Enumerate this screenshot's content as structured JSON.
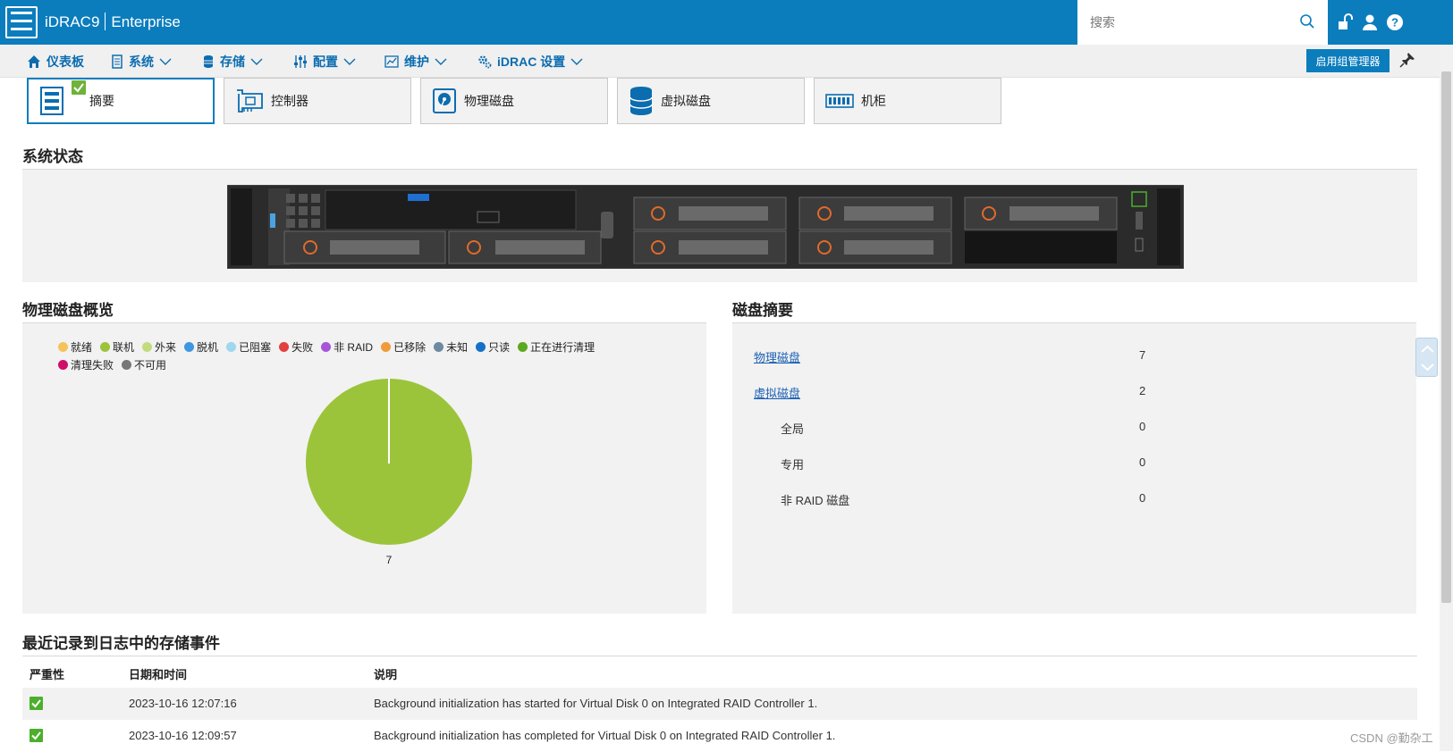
{
  "header": {
    "product": "iDRAC9",
    "edition": "Enterprise",
    "search_placeholder": "搜索",
    "colors": {
      "header_bg": "#0b7dbd",
      "accent": "#0b6db0"
    }
  },
  "nav": {
    "items": [
      {
        "label": "仪表板",
        "icon": "home-icon"
      },
      {
        "label": "系统",
        "icon": "server-icon"
      },
      {
        "label": "存储",
        "icon": "database-icon"
      },
      {
        "label": "配置",
        "icon": "sliders-icon"
      },
      {
        "label": "维护",
        "icon": "chart-icon"
      },
      {
        "label": "iDRAC 设置",
        "icon": "gears-icon"
      }
    ],
    "group_manager_button": "启用组管理器"
  },
  "tabs": [
    {
      "label": "摘要",
      "icon": "summary-icon",
      "active": true
    },
    {
      "label": "控制器",
      "icon": "controller-icon",
      "active": false
    },
    {
      "label": "物理磁盘",
      "icon": "physical-disk-icon",
      "active": false
    },
    {
      "label": "虚拟磁盘",
      "icon": "virtual-disk-icon",
      "active": false
    },
    {
      "label": "机柜",
      "icon": "enclosure-icon",
      "active": false
    }
  ],
  "system_status": {
    "title": "系统状态"
  },
  "disk_overview": {
    "title": "物理磁盘概览",
    "legend": [
      {
        "label": "就绪",
        "color": "#f5c35b"
      },
      {
        "label": "联机",
        "color": "#9bc43b"
      },
      {
        "label": "外来",
        "color": "#c1dc7e"
      },
      {
        "label": "脱机",
        "color": "#3f97e0"
      },
      {
        "label": "已阻塞",
        "color": "#9fd7f0"
      },
      {
        "label": "失败",
        "color": "#e2403e"
      },
      {
        "label": "非 RAID",
        "color": "#a555d8"
      },
      {
        "label": "已移除",
        "color": "#f09a3a"
      },
      {
        "label": "未知",
        "color": "#6e8aa0"
      },
      {
        "label": "只读",
        "color": "#1371c8"
      },
      {
        "label": "正在进行清理",
        "color": "#5ca81e"
      },
      {
        "label": "清理失败",
        "color": "#d10d6a"
      },
      {
        "label": "不可用",
        "color": "#777777"
      }
    ]
  },
  "chart_data": {
    "type": "pie",
    "title": "",
    "categories": [
      "联机"
    ],
    "values": [
      7
    ],
    "colors": [
      "#9bc43b"
    ],
    "data_labels": [
      "7"
    ]
  },
  "disk_summary": {
    "title": "磁盘摘要",
    "rows": [
      {
        "label": "物理磁盘",
        "value": "7",
        "link": true
      },
      {
        "label": "虚拟磁盘",
        "value": "2",
        "link": true
      },
      {
        "label": "全局",
        "value": "0",
        "link": false
      },
      {
        "label": "专用",
        "value": "0",
        "link": false
      },
      {
        "label": "非 RAID 磁盘",
        "value": "0",
        "link": false
      }
    ]
  },
  "events": {
    "title": "最近记录到日志中的存储事件",
    "columns": [
      "严重性",
      "日期和时间",
      "说明"
    ],
    "rows": [
      {
        "severity": "ok",
        "datetime": "2023-10-16 12:07:16",
        "description": "Background initialization has started for Virtual Disk 0 on Integrated RAID Controller 1."
      },
      {
        "severity": "ok",
        "datetime": "2023-10-16 12:09:57",
        "description": "Background initialization has completed for Virtual Disk 0 on Integrated RAID Controller 1."
      }
    ]
  },
  "watermark": "CSDN @勤杂工"
}
